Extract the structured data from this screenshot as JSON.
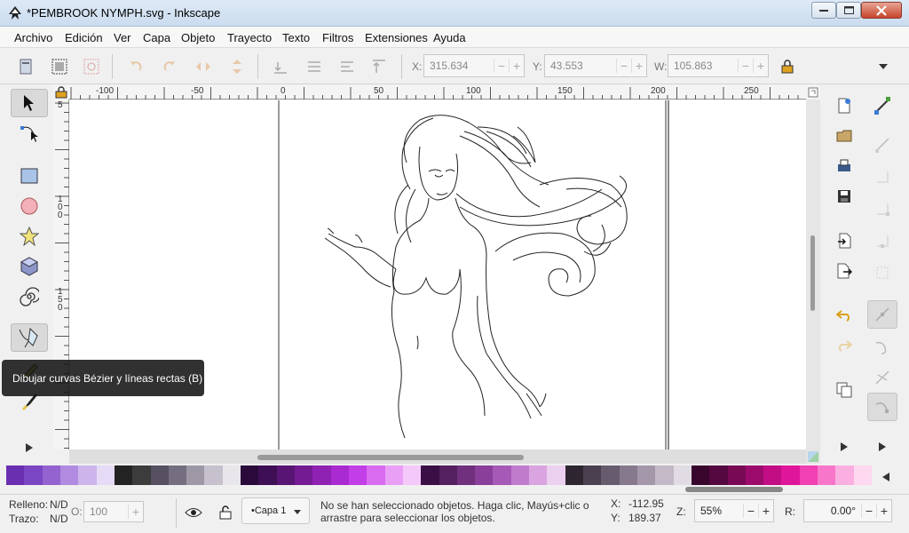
{
  "window": {
    "title": "*PEMBROOK NYMPH.svg - Inkscape",
    "icon": "inkscape-logo-icon"
  },
  "menubar": {
    "items": [
      "Archivo",
      "Edición",
      "Ver",
      "Capa",
      "Objeto",
      "Trayecto",
      "Texto",
      "Filtros",
      "Extensiones",
      "Ayuda"
    ]
  },
  "toolbar": {
    "x_label": "X:",
    "x_value": "315.634",
    "y_label": "Y:",
    "y_value": "43.553",
    "w_label": "W:",
    "w_value": "105.863",
    "spin_minus": "−",
    "spin_plus": "+"
  },
  "ruler": {
    "top_labels": [
      "-100",
      "-50",
      "0",
      "50",
      "100",
      "150",
      "200",
      "250"
    ],
    "left_labels": [
      "5",
      "1\n0\n0",
      "1\n5\n0"
    ]
  },
  "tooltip": {
    "text": "Dibujar curvas Bézier y líneas rectas (B)"
  },
  "palette": {
    "colors": [
      "#6a2fb1",
      "#7b46c4",
      "#9463cf",
      "#b08be0",
      "#cdb5ec",
      "#e6dbf6",
      "#232323",
      "#3c3c3c",
      "#575060",
      "#756e80",
      "#9d97a6",
      "#c6c1cc",
      "#e8e6ea",
      "#2a0a3a",
      "#3e0f55",
      "#591574",
      "#741b94",
      "#8f21b3",
      "#a82ad0",
      "#c23ee6",
      "#d96bf0",
      "#ea9ff6",
      "#f4c9fa",
      "#3a0f45",
      "#55205f",
      "#70307d",
      "#8a3f9a",
      "#a659b6",
      "#c07bcc",
      "#d9a4e0",
      "#ecd0ef",
      "#2d2630",
      "#4a4050",
      "#675c6e",
      "#86798d",
      "#a497aa",
      "#c3b9c7",
      "#e1dbe3",
      "#38062d",
      "#54083f",
      "#780a55",
      "#9c0a6c",
      "#c20d84",
      "#e0169a",
      "#f040b2",
      "#f876c9",
      "#fbaee0",
      "#fdd8ef"
    ]
  },
  "statusbar": {
    "fill_label": "Relleno:",
    "fill_value": "N/D",
    "stroke_label": "Trazo:",
    "stroke_value": "N/D",
    "opacity_label": "O:",
    "opacity_value": "100",
    "layer": "•Capa 1",
    "message_line1": "No se han seleccionado objetos. Haga clic, Mayús+clic o",
    "message_line2": "arrastre para seleccionar los objetos.",
    "cursor_x_label": "X:",
    "cursor_x": "-112.95",
    "cursor_y_label": "Y:",
    "cursor_y": "189.37",
    "zoom_label": "Z:",
    "zoom": "55%",
    "rotation_label": "R:",
    "rotation": "0.00°",
    "minus": "−",
    "plus": "+"
  }
}
